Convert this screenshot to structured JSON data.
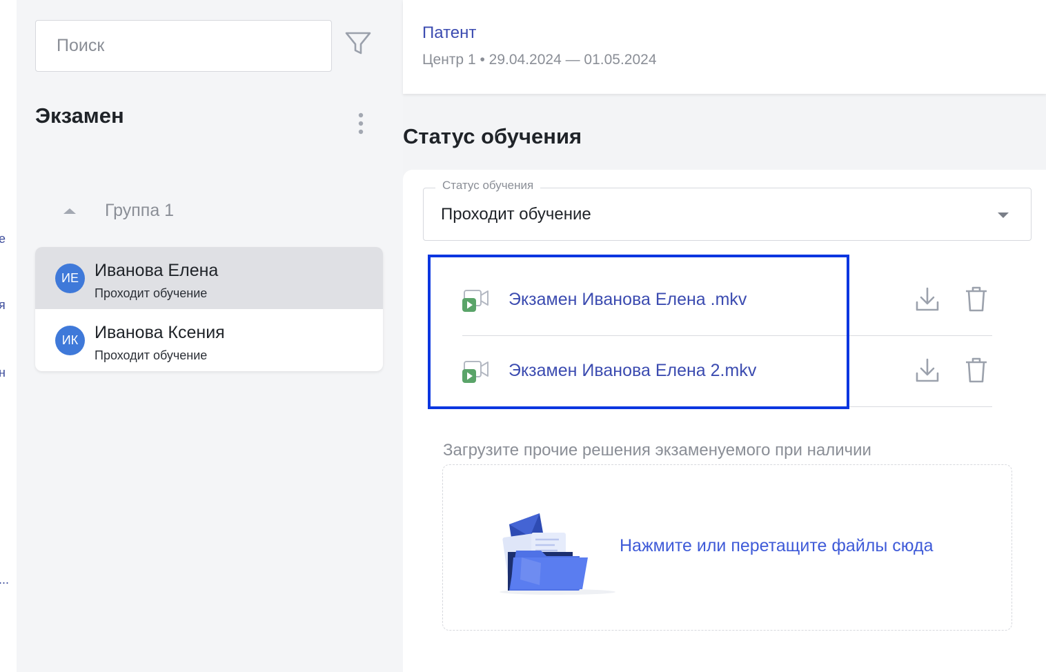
{
  "nav": {
    "fragments": [
      "е",
      "я",
      "н",
      "..."
    ]
  },
  "search": {
    "placeholder": "Поиск"
  },
  "sidebar": {
    "title": "Экзамен",
    "group": {
      "label": "Группа 1"
    },
    "users": [
      {
        "initials": "ИЕ",
        "name": "Иванова Елена",
        "status": "Проходит обучение",
        "active": true
      },
      {
        "initials": "ИК",
        "name": "Иванова Ксения",
        "status": "Проходит обучение",
        "active": false
      }
    ]
  },
  "header": {
    "title": "Патент",
    "meta": "Центр 1 • 29.04.2024 — 01.05.2024"
  },
  "main": {
    "heading": "Статус обучения",
    "status_select": {
      "legend": "Статус обучения",
      "value": "Проходит обучение"
    },
    "files": [
      {
        "name": "Экзамен Иванова Елена .mkv"
      },
      {
        "name": "Экзамен Иванова Елена 2.mkv"
      }
    ],
    "upload": {
      "label": "Загрузите прочие решения экзаменуемого при наличии",
      "dropzone_text": "Нажмите или перетащите файлы сюда"
    }
  },
  "colors": {
    "accent": "#3b4bb0",
    "avatar": "#3f79d9",
    "highlight": "#0b36e0",
    "video_play": "#5aa469"
  },
  "icons": [
    "filter-icon",
    "kebab-menu-icon",
    "caret-up-icon",
    "chevron-down-icon",
    "video-file-icon",
    "download-icon",
    "trash-icon",
    "folder-illustration"
  ]
}
